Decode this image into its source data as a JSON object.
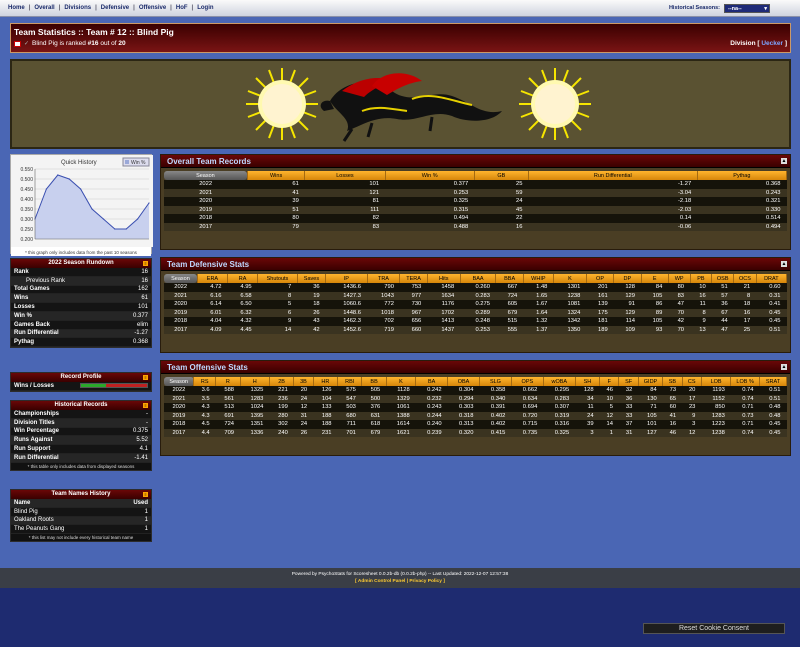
{
  "nav": {
    "links": [
      "Home",
      "Overall",
      "Divisions",
      "Defensive",
      "Offensive",
      "HoF",
      "Login"
    ],
    "historical_label": "Historical Seasons:",
    "historical_value": "--na--"
  },
  "title": {
    "main": "Team Statistics :: Team # 12 :: Blind Pig",
    "ranked_prefix": "Blind Pig is ranked ",
    "rank": "#16",
    "ranked_mid": " out of ",
    "total": "20",
    "division_label": "Division [ ",
    "division_value": "Uecker",
    "division_close": " ]"
  },
  "quick_history": {
    "title": "Quick History",
    "legend": "Win %",
    "yticks": [
      "0.550",
      "0.500",
      "0.450",
      "0.400",
      "0.350",
      "0.300",
      "0.250",
      "0.200"
    ],
    "footnote": "* this graph only includes data from the past 10 seasons"
  },
  "chart_data": {
    "type": "area",
    "title": "Quick History",
    "ylim": [
      0.2,
      0.55
    ],
    "series": [
      {
        "name": "Win %",
        "values": [
          0.3,
          0.45,
          0.52,
          0.5,
          0.45,
          0.35,
          0.3,
          0.25,
          0.25,
          0.3,
          0.38
        ]
      }
    ],
    "legend": "top-right"
  },
  "rundown": {
    "title": "2022 Season Rundown",
    "rows": [
      {
        "label": "Rank",
        "value": "16"
      },
      {
        "label": "Previous Rank",
        "value": "16"
      },
      {
        "label": "Total Games",
        "value": "162"
      },
      {
        "label": "Wins",
        "value": "61"
      },
      {
        "label": "Losses",
        "value": "101"
      },
      {
        "label": "Win %",
        "value": "0.377"
      },
      {
        "label": "Games Back",
        "value": "elim"
      },
      {
        "label": "Run Differential",
        "value": "-1.27"
      },
      {
        "label": "Pythag",
        "value": "0.368"
      }
    ]
  },
  "profile": {
    "title": "Record Profile",
    "label": "Wins / Losses",
    "win_fraction": 0.377,
    "win_color": "#2aa82a",
    "loss_color": "#c02020"
  },
  "historical": {
    "title": "Historical Records",
    "rows": [
      {
        "label": "Championships",
        "value": "-"
      },
      {
        "label": "Division Titles",
        "value": "-"
      },
      {
        "label": "Win Percentage",
        "value": "0.375"
      },
      {
        "label": "Runs Against",
        "value": "5.52"
      },
      {
        "label": "Run Support",
        "value": "4.1"
      },
      {
        "label": "Run Differential",
        "value": "-1.41"
      }
    ],
    "footnote": "* this table only includes data from displayed seasons"
  },
  "names": {
    "title": "Team Names History",
    "col_name": "Name",
    "col_used": "Used",
    "rows": [
      {
        "name": "Blind Pig",
        "used": "1"
      },
      {
        "name": "Oakland Roots",
        "used": "1"
      },
      {
        "name": "The Peanuts Gang",
        "used": "1"
      }
    ],
    "footnote": "* this list may not include every historical team name"
  },
  "overall": {
    "title": "Overall Team Records",
    "headers": [
      "Season",
      "Wins",
      "Losses",
      "Win %",
      "GB",
      "Run Differential",
      "Pythag"
    ],
    "rows": [
      [
        "2022",
        "61",
        "101",
        "0.377",
        "25",
        "-1.27",
        "0.368"
      ],
      [
        "2021",
        "41",
        "121",
        "0.253",
        "59",
        "-3.04",
        "0.243"
      ],
      [
        "2020",
        "39",
        "81",
        "0.325",
        "24",
        "-2.18",
        "0.321"
      ],
      [
        "2019",
        "51",
        "111",
        "0.315",
        "45",
        "-2.03",
        "0.330"
      ],
      [
        "2018",
        "80",
        "82",
        "0.494",
        "22",
        "0.14",
        "0.514"
      ],
      [
        "2017",
        "79",
        "83",
        "0.488",
        "16",
        "-0.06",
        "0.494"
      ]
    ]
  },
  "defensive": {
    "title": "Team Defensive Stats",
    "headers": [
      "Season",
      "ERA",
      "RA",
      "Shutouts",
      "Saves",
      "IP",
      "TRA",
      "TERA",
      "Hits",
      "BAA",
      "BBA",
      "WHIP",
      "K",
      "OP",
      "DP",
      "E",
      "WP",
      "PB",
      "OSB",
      "OCS",
      "DRAT"
    ],
    "rows": [
      [
        "2022",
        "4.72",
        "4.95",
        "7",
        "36",
        "1436.6",
        "790",
        "753",
        "1458",
        "0.260",
        "667",
        "1.48",
        "1301",
        "201",
        "128",
        "84",
        "80",
        "10",
        "51",
        "21",
        "0.60"
      ],
      [
        "2021",
        "6.16",
        "6.58",
        "8",
        "19",
        "1427.3",
        "1043",
        "977",
        "1634",
        "0.283",
        "724",
        "1.65",
        "1238",
        "161",
        "129",
        "105",
        "83",
        "16",
        "57",
        "8",
        "0.31"
      ],
      [
        "2020",
        "6.14",
        "6.50",
        "5",
        "18",
        "1060.6",
        "772",
        "730",
        "1176",
        "0.275",
        "605",
        "1.67",
        "1081",
        "139",
        "91",
        "86",
        "47",
        "11",
        "36",
        "18",
        "0.41"
      ],
      [
        "2019",
        "6.01",
        "6.32",
        "6",
        "26",
        "1448.6",
        "1018",
        "967",
        "1702",
        "0.289",
        "679",
        "1.64",
        "1324",
        "175",
        "129",
        "89",
        "70",
        "8",
        "67",
        "16",
        "0.45"
      ],
      [
        "2018",
        "4.04",
        "4.32",
        "9",
        "43",
        "1462.3",
        "702",
        "656",
        "1413",
        "0.248",
        "515",
        "1.32",
        "1342",
        "181",
        "114",
        "105",
        "42",
        "9",
        "44",
        "17",
        "0.45"
      ],
      [
        "2017",
        "4.09",
        "4.45",
        "14",
        "42",
        "1452.6",
        "719",
        "660",
        "1437",
        "0.253",
        "555",
        "1.37",
        "1350",
        "189",
        "109",
        "93",
        "70",
        "13",
        "47",
        "25",
        "0.51"
      ]
    ]
  },
  "offensive": {
    "title": "Team Offensive Stats",
    "headers": [
      "Season",
      "RS",
      "R",
      "H",
      "2B",
      "3B",
      "HR",
      "RBI",
      "BB",
      "K",
      "BA",
      "OBA",
      "SLG",
      "OPS",
      "wOBA",
      "SH",
      "F",
      "SF",
      "GIDP",
      "SB",
      "CS",
      "LOB",
      "LOB %",
      "SRAT"
    ],
    "rows": [
      [
        "2022",
        "3.6",
        "588",
        "1325",
        "221",
        "20",
        "126",
        "575",
        "505",
        "1128",
        "0.242",
        "0.304",
        "0.358",
        "0.662",
        "0.295",
        "128",
        "46",
        "32",
        "84",
        "73",
        "20",
        "1193",
        "0.74",
        "0.51"
      ],
      [
        "2021",
        "3.5",
        "561",
        "1283",
        "236",
        "24",
        "104",
        "547",
        "500",
        "1329",
        "0.232",
        "0.294",
        "0.340",
        "0.634",
        "0.283",
        "34",
        "10",
        "36",
        "130",
        "65",
        "17",
        "1152",
        "0.74",
        "0.51"
      ],
      [
        "2020",
        "4.3",
        "513",
        "1024",
        "199",
        "12",
        "133",
        "503",
        "376",
        "1061",
        "0.243",
        "0.303",
        "0.391",
        "0.694",
        "0.307",
        "11",
        "5",
        "33",
        "71",
        "60",
        "23",
        "850",
        "0.71",
        "0.48"
      ],
      [
        "2019",
        "4.3",
        "691",
        "1395",
        "280",
        "31",
        "188",
        "680",
        "631",
        "1388",
        "0.244",
        "0.318",
        "0.402",
        "0.720",
        "0.319",
        "24",
        "12",
        "33",
        "105",
        "41",
        "9",
        "1283",
        "0.73",
        "0.48"
      ],
      [
        "2018",
        "4.5",
        "724",
        "1351",
        "302",
        "24",
        "188",
        "711",
        "618",
        "1614",
        "0.240",
        "0.313",
        "0.402",
        "0.715",
        "0.316",
        "39",
        "14",
        "37",
        "101",
        "16",
        "3",
        "1223",
        "0.71",
        "0.45"
      ],
      [
        "2017",
        "4.4",
        "709",
        "1336",
        "240",
        "26",
        "231",
        "701",
        "679",
        "1621",
        "0.239",
        "0.320",
        "0.415",
        "0.735",
        "0.325",
        "3",
        "1",
        "31",
        "127",
        "46",
        "12",
        "1238",
        "0.74",
        "0.45"
      ]
    ]
  },
  "footer": {
    "line1": "Powered by PsychoStats for Scoresheet 0.0.2b-db (0.0.2b-php) -- Last Updated: 2022-12-07 12:57:38",
    "admin": "Admin Control Panel",
    "privacy": "Privacy Policy"
  },
  "cookie_button": "Reset Cookie Consent"
}
